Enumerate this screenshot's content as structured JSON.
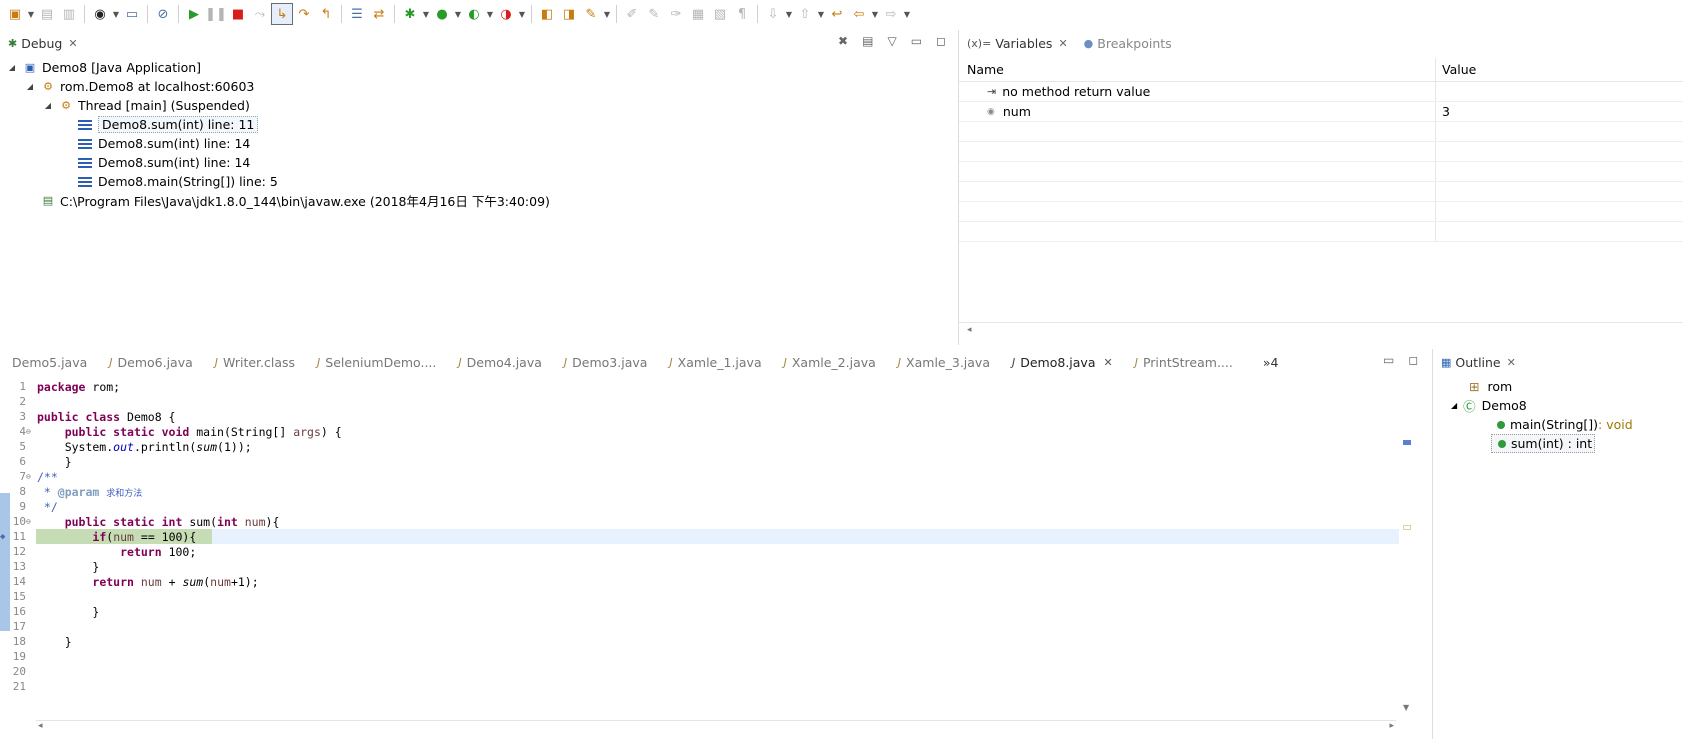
{
  "toolbar": {
    "icons": [
      "new-icon",
      "save-icon",
      "save-all-icon",
      "profile-icon",
      "console-icon",
      "skip-breakpoints-icon",
      "resume-icon",
      "suspend-icon",
      "terminate-icon",
      "disconnect-icon",
      "step-into-icon",
      "step-over-icon",
      "step-return-icon",
      "drop-to-frame-icon",
      "use-step-filters-icon",
      "debug-icon",
      "run-icon",
      "coverage-icon",
      "external-tools-icon",
      "new-java-project-icon",
      "open-type-icon",
      "search-icon",
      "toggle-mark-icon",
      "prev-annotation-icon",
      "next-annotation-icon",
      "last-edit-icon",
      "back-icon",
      "forward-icon"
    ]
  },
  "debug": {
    "tab_label": "Debug",
    "tree": {
      "launch": "Demo8 [Java Application]",
      "target": "rom.Demo8 at localhost:60603",
      "thread": "Thread [main] (Suspended)",
      "frames": [
        "Demo8.sum(int) line: 11",
        "Demo8.sum(int) line: 14",
        "Demo8.sum(int) line: 14",
        "Demo8.main(String[]) line: 5"
      ],
      "process": "C:\\Program Files\\Java\\jdk1.8.0_144\\bin\\javaw.exe (2018年4月16日 下午3:40:09)"
    }
  },
  "variables": {
    "tab_label": "Variables",
    "tab_prefix": "(x)=",
    "breakpoints_label": "Breakpoints",
    "col_name": "Name",
    "col_value": "Value",
    "rows": [
      {
        "name": "no method return value",
        "value": ""
      },
      {
        "name": "num",
        "value": "3"
      }
    ]
  },
  "editor": {
    "tabs": [
      "Demo5.java",
      "Demo6.java",
      "Writer.class",
      "SeleniumDemo....",
      "Demo4.java",
      "Demo3.java",
      "Xamle_1.java",
      "Xamle_2.java",
      "Xamle_3.java",
      "Demo8.java",
      "PrintStream...."
    ],
    "overflow": "»4",
    "line_numbers": [
      "1",
      "2",
      "3",
      "4",
      "5",
      "6",
      "7",
      "8",
      "9",
      "10",
      "11",
      "12",
      "13",
      "14",
      "15",
      "16",
      "17",
      "18",
      "19",
      "20",
      "21"
    ]
  },
  "outline": {
    "tab_label": "Outline",
    "items": {
      "package": "rom",
      "class": "Demo8",
      "main": "main(String[])",
      "main_ret": " : void",
      "sum": "sum(int) : int"
    }
  }
}
